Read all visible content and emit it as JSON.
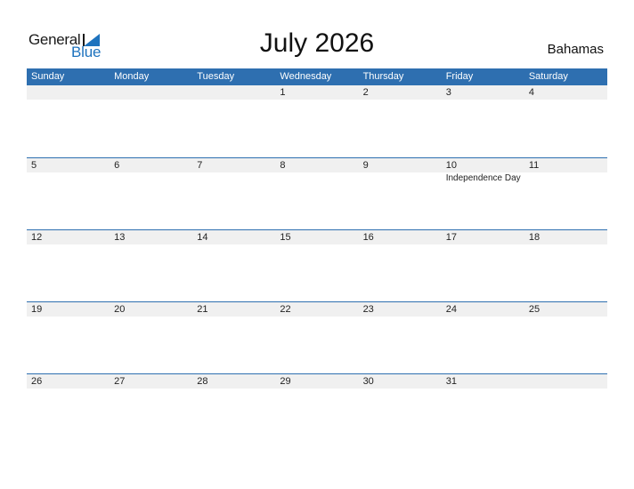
{
  "logo": {
    "part1": "General",
    "part2": "Blue",
    "accent": "#1e73be"
  },
  "title": "July 2026",
  "country": "Bahamas",
  "header_color": "#2e6fb0",
  "weekdays": [
    "Sunday",
    "Monday",
    "Tuesday",
    "Wednesday",
    "Thursday",
    "Friday",
    "Saturday"
  ],
  "weeks": [
    {
      "days": [
        "",
        "",
        "",
        "1",
        "2",
        "3",
        "4"
      ],
      "events": [
        "",
        "",
        "",
        "",
        "",
        "",
        ""
      ]
    },
    {
      "days": [
        "5",
        "6",
        "7",
        "8",
        "9",
        "10",
        "11"
      ],
      "events": [
        "",
        "",
        "",
        "",
        "",
        "Independence Day",
        ""
      ]
    },
    {
      "days": [
        "12",
        "13",
        "14",
        "15",
        "16",
        "17",
        "18"
      ],
      "events": [
        "",
        "",
        "",
        "",
        "",
        "",
        ""
      ]
    },
    {
      "days": [
        "19",
        "20",
        "21",
        "22",
        "23",
        "24",
        "25"
      ],
      "events": [
        "",
        "",
        "",
        "",
        "",
        "",
        ""
      ]
    },
    {
      "days": [
        "26",
        "27",
        "28",
        "29",
        "30",
        "31",
        ""
      ],
      "events": [
        "",
        "",
        "",
        "",
        "",
        "",
        ""
      ]
    }
  ]
}
